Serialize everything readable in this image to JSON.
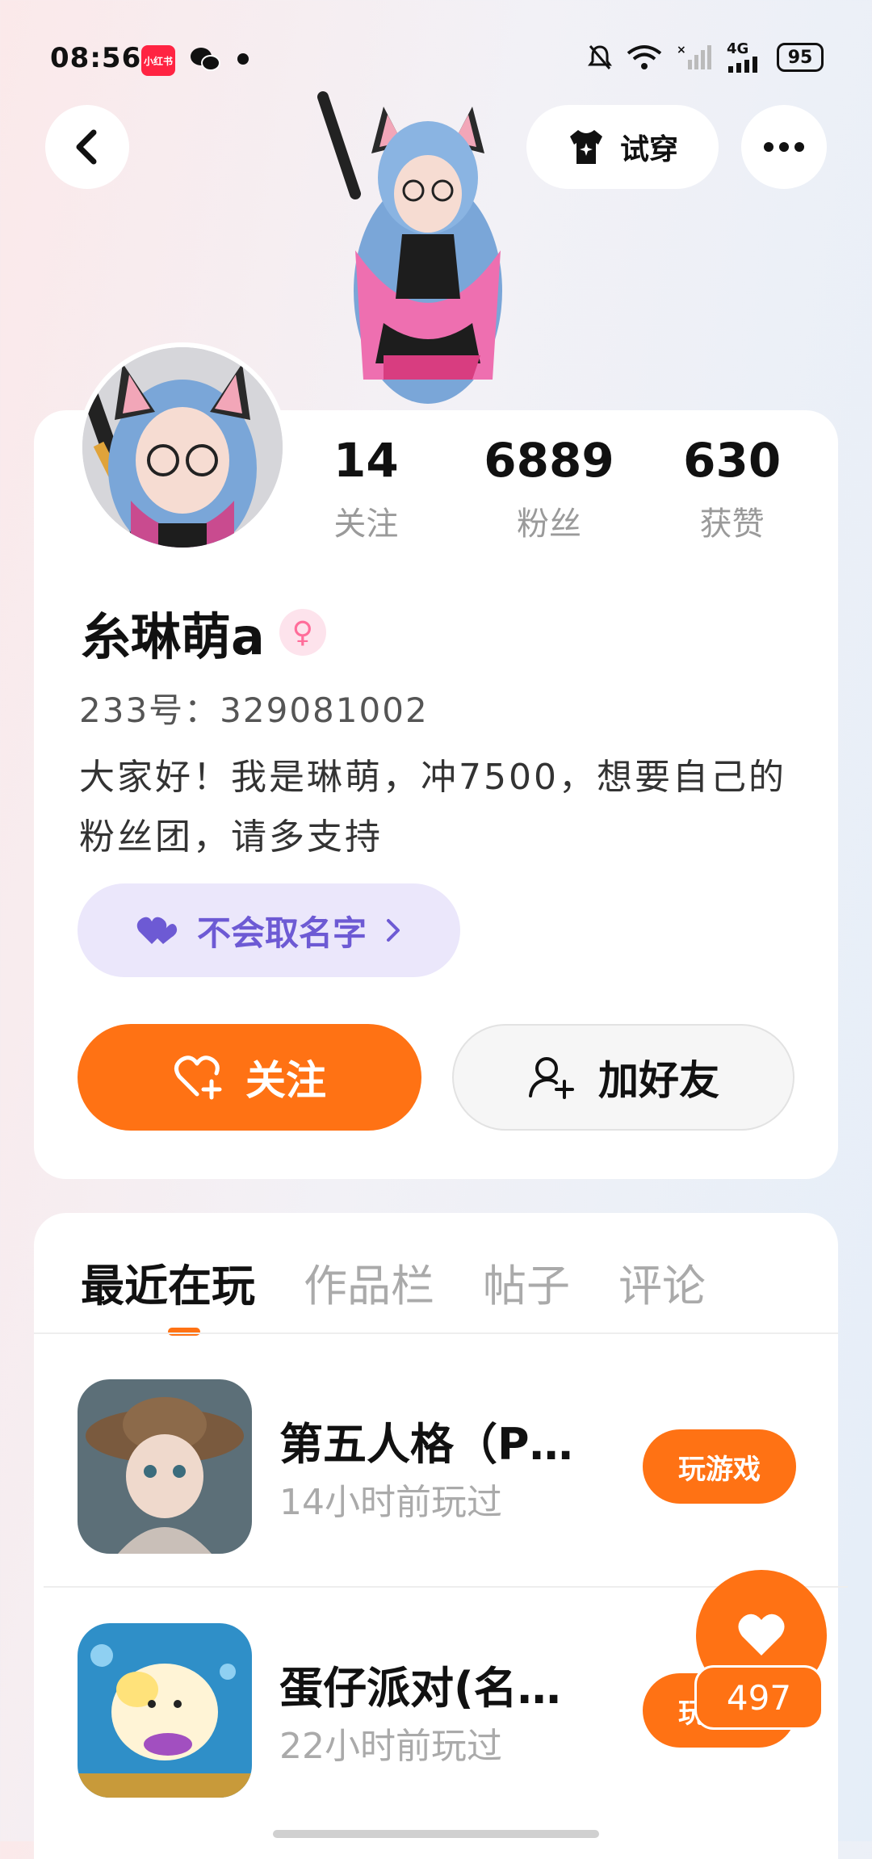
{
  "status_bar": {
    "time": "08:56",
    "app_badge": "小红书",
    "network": "4G",
    "battery": "95"
  },
  "header": {
    "try_on_label": "试穿"
  },
  "profile": {
    "stats": [
      {
        "value": "14",
        "label": "关注"
      },
      {
        "value": "6889",
        "label": "粉丝"
      },
      {
        "value": "630",
        "label": "获赞"
      }
    ],
    "name": "糸琳萌a",
    "gender_symbol": "♀",
    "uid": "233号：329081002",
    "bio": "大家好！我是琳萌，冲7500，想要自己的粉丝团，请多支持",
    "fan_tag": "不会取名字",
    "follow_label": "关注",
    "add_friend_label": "加好友"
  },
  "tabs": [
    {
      "label": "最近在玩",
      "active": true
    },
    {
      "label": "作品栏",
      "active": false
    },
    {
      "label": "帖子",
      "active": false
    },
    {
      "label": "评论",
      "active": false
    }
  ],
  "games": [
    {
      "title": "第五人格（P…",
      "time": "14小时前玩过",
      "button": "玩游戏"
    },
    {
      "title": "蛋仔派对(名…",
      "time": "22小时前玩过",
      "button": "玩游戏"
    }
  ],
  "floating_like": {
    "count": "497"
  },
  "colors": {
    "accent": "#ff7214",
    "tag_bg": "#ebe7fb",
    "tag_text": "#6d5ad4"
  }
}
